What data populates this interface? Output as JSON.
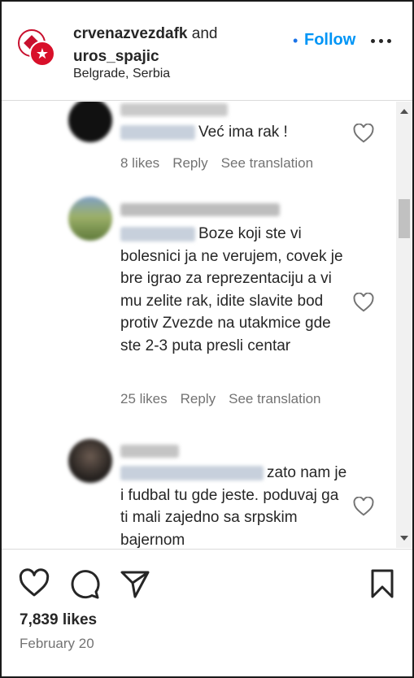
{
  "header": {
    "owner": "crvenazvezdafk",
    "and": "and",
    "collaborator": "uros_spajic",
    "location": "Belgrade, Serbia",
    "dot": "•",
    "follow_label": "Follow",
    "more_icon": "more-icon"
  },
  "comments": [
    {
      "text": "Već ima rak !",
      "likes": "8 likes",
      "reply": "Reply",
      "translate": "See translation"
    },
    {
      "text": "Boze koji ste vi bolesnici ja ne verujem, covek je bre igrao za reprezentaciju a vi mu zelite rak, idite slavite bod protiv Zvezde na utakmice gde ste 2-3 puta presli centar",
      "likes": "25 likes",
      "reply": "Reply",
      "translate": "See translation"
    },
    {
      "text": "zato nam je i fudbal tu gde jeste. poduvaj ga ti mali zajedno sa srpskim bajernom"
    }
  ],
  "footer": {
    "likes": "7,839 likes",
    "date": "February 20"
  },
  "colors": {
    "accent": "#0095f6",
    "club_red": "#d8102a",
    "muted": "#737373"
  }
}
